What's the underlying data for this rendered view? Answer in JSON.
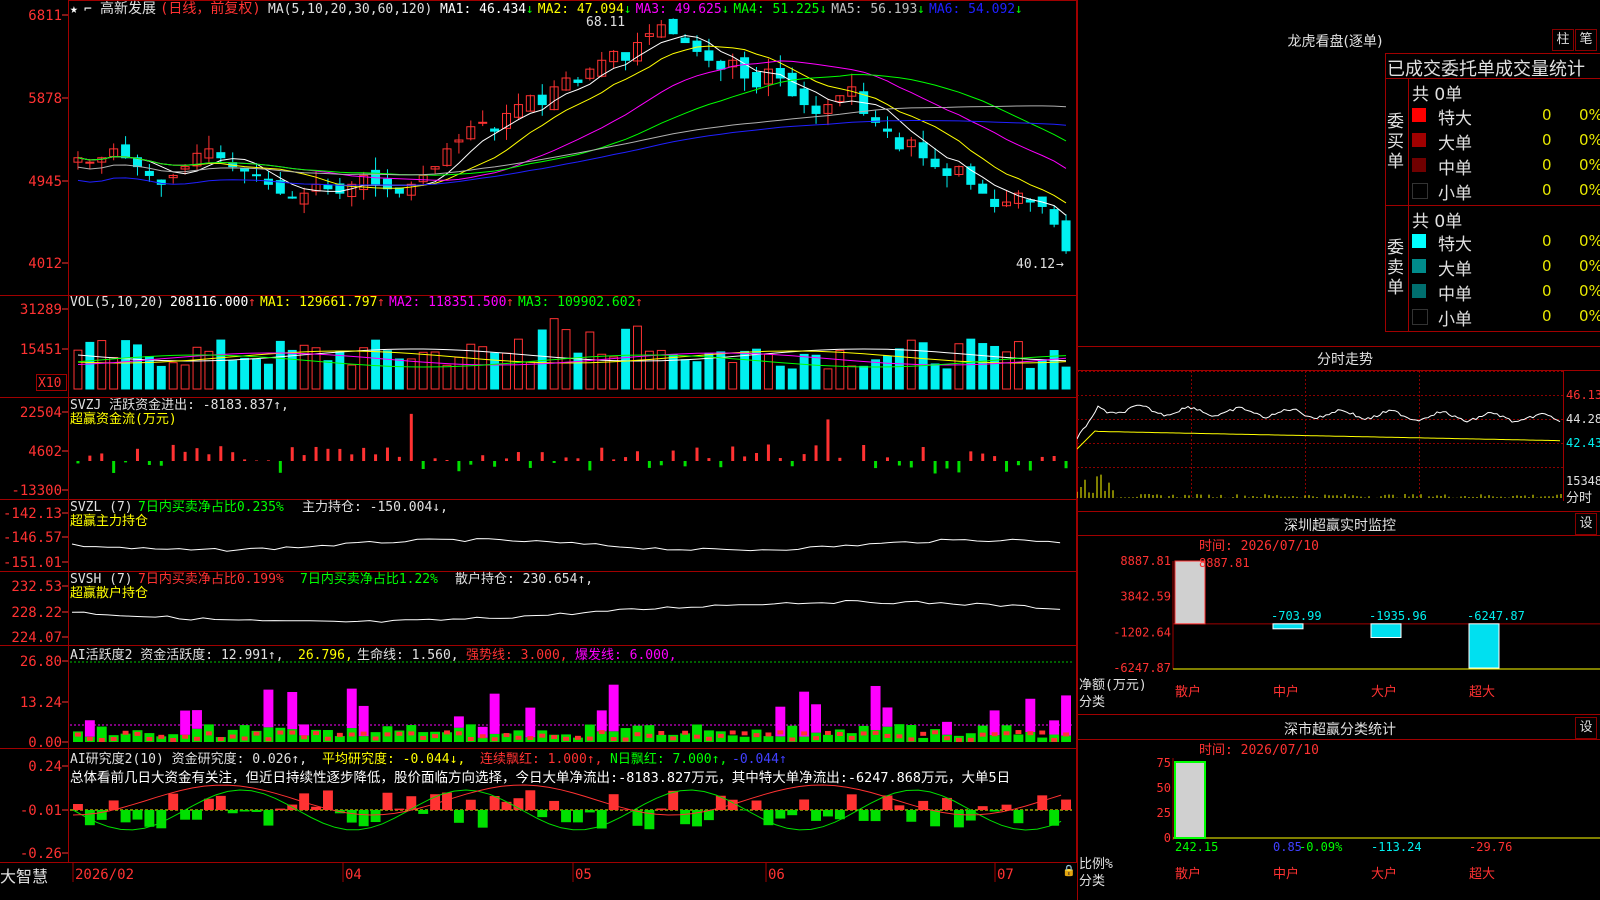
{
  "app": {
    "brand": "大智慧",
    "stock": "高新发展",
    "period": "(日线，前复权)"
  },
  "colors": {
    "up": "#ff3232",
    "down": "#00f0f0",
    "grid": "#8b0000",
    "ma1": "#ffffff",
    "ma2": "#ffff00",
    "ma3": "#ff00ff",
    "ma4": "#00ff00",
    "ma5": "#b0b0b0",
    "ma6": "#2020ff",
    "green": "#00e000"
  },
  "price_panel": {
    "ma_header": "MA(5,10,20,30,60,120)",
    "ma": [
      {
        "label": "MA1: 46.434",
        "arrow": "↓",
        "color": "#ffffff"
      },
      {
        "label": "MA2: 47.094",
        "arrow": "↓",
        "color": "#ffff00"
      },
      {
        "label": "MA3: 49.625",
        "arrow": "↓",
        "color": "#ff00ff"
      },
      {
        "label": "MA4: 51.225",
        "arrow": "↓",
        "color": "#00ff00"
      },
      {
        "label": "MA5: 56.193",
        "arrow": "↓",
        "color": "#c0c0c0"
      },
      {
        "label": "MA6: 54.092",
        "arrow": "↓",
        "color": "#2020ff"
      }
    ],
    "yticks": [
      "6811",
      "5878",
      "4945",
      "4012"
    ],
    "high_label": "68.11",
    "low_label": "40.12"
  },
  "volume_panel": {
    "header": "VOL(5,10,20)",
    "items": [
      {
        "label": "208116.000",
        "arrow": "↑",
        "color": "#ffffff"
      },
      {
        "label": "MA1: 129661.797",
        "arrow": "↑",
        "color": "#ffff00"
      },
      {
        "label": "MA2: 118351.500",
        "arrow": "↑",
        "color": "#ff00ff"
      },
      {
        "label": "MA3: 109902.602",
        "arrow": "↑",
        "color": "#00ff00"
      }
    ],
    "yticks": [
      "31289",
      "15451"
    ],
    "unit": "X10"
  },
  "svzj_panel": {
    "line1": "SVZJ  活跃资金进出: -8183.837↑,",
    "line2": "超赢资金流(万元)",
    "yticks": [
      "22504",
      "4602",
      "-13300"
    ]
  },
  "svzl_panel": {
    "prefix": "SVZL (7)",
    "part1": "7日内买卖净占比0.235%",
    "part2": "主力持仓: -150.004↓,",
    "line2": "超赢主力持仓",
    "yticks": [
      "-142.13",
      "-146.57",
      "-151.01"
    ]
  },
  "svsh_panel": {
    "prefix": "SVSH (7)",
    "part1": "7日内买卖净占比0.199%",
    "part2": "7日内买卖净占比1.22%",
    "part3": "散户持仓: 230.654↑,",
    "line2": "超赢散户持仓",
    "yticks": [
      "232.53",
      "228.22",
      "224.07"
    ]
  },
  "ai_active_panel": {
    "p1": "AI活跃度2 资金活跃度: 12.991↑,",
    "p2": "26.796,",
    "p3": "生命线: 1.560,",
    "p4": "强势线: 3.000,",
    "p5": "爆发线: 6.000,",
    "yticks": [
      "26.80",
      "13.24",
      "0.00"
    ]
  },
  "ai_research_panel": {
    "p1": "AI研究度2(10) 资金研究度: 0.026↑,",
    "p2": "平均研究度: -0.044↓,",
    "p3": "连续飘红: 1.000↑,",
    "p4": "N日飘红: 7.000↑,",
    "p5": "-0.044↑",
    "summary": "总体看前几日大资金有关注，但近日持续性逐步降低，股价面临方向选择，今日大单净流出:-8183.827万元，其中特大单净流出:-6247.868万元，大单5日",
    "yticks": [
      "0.24",
      "-0.01",
      "-0.26"
    ]
  },
  "x_axis": [
    "2026/02",
    "04",
    "05",
    "06",
    "07"
  ],
  "dragon_tiger": {
    "title": "龙虎看盘(逐单)",
    "btn1": "柱",
    "btn2": "笔",
    "subtitle": "已成交委托单成交量统计",
    "buy_total": "共 0单",
    "sell_total": "共 0单",
    "buy_label": "委买单",
    "sell_label": "委卖单",
    "buy_rows": [
      {
        "name": "特大",
        "count": "0",
        "pct": "0%",
        "color": "#ff0000"
      },
      {
        "name": "大单",
        "count": "0",
        "pct": "0%",
        "color": "#a00000"
      },
      {
        "name": "中单",
        "count": "0",
        "pct": "0%",
        "color": "#700000"
      },
      {
        "name": "小单",
        "count": "0",
        "pct": "0%",
        "color": "#000000"
      }
    ],
    "sell_rows": [
      {
        "name": "特大",
        "count": "0",
        "pct": "0%",
        "color": "#00ffff"
      },
      {
        "name": "大单",
        "count": "0",
        "pct": "0%",
        "color": "#008b8b"
      },
      {
        "name": "中单",
        "count": "0",
        "pct": "0%",
        "color": "#006f6f"
      },
      {
        "name": "小单",
        "count": "0",
        "pct": "0%",
        "color": "#000000"
      }
    ]
  },
  "intraday": {
    "title": "分时走势",
    "yticks": [
      "46.13",
      "44.28",
      "42.43"
    ],
    "vol_label": "15348",
    "bottom_label": "分时"
  },
  "sz_monitor": {
    "title": "深圳超赢实时监控",
    "settings": "设",
    "date": "时间: 2026/07/10",
    "top_value": "8887.81",
    "yticks": [
      "8887.81",
      "3842.59",
      "-1202.64",
      "-6247.87"
    ],
    "ylabel": "净额(万元)",
    "xlabel": "分类",
    "categories": [
      "散户",
      "中户",
      "大户",
      "超大"
    ]
  },
  "sz_class": {
    "title": "深市超赢分类统计",
    "settings": "设",
    "date": "时间: 2026/07/10",
    "yticks": [
      "75",
      "50",
      "25",
      "0"
    ],
    "ylabel": "比例%",
    "xlabel": "分类",
    "categories": [
      "散户",
      "中户",
      "大户",
      "超大"
    ],
    "mid_label": "-0.09%"
  },
  "chart_data": [
    {
      "type": "bar",
      "title": "深圳超赢实时监控",
      "ylabel": "净额(万元)",
      "xlabel": "分类",
      "categories": [
        "散户",
        "中户",
        "大户",
        "超大"
      ],
      "values": [
        8887.81,
        -703.99,
        -1935.96,
        -6247.87
      ],
      "ylim": [
        -6247.87,
        8887.81
      ]
    },
    {
      "type": "bar",
      "title": "深市超赢分类统计",
      "ylabel": "比例%",
      "xlabel": "分类",
      "categories": [
        "散户",
        "中户",
        "大户",
        "超大"
      ],
      "values": [
        242.15,
        0.85,
        -113.24,
        -29.76
      ],
      "ylim": [
        0,
        75
      ]
    },
    {
      "type": "line",
      "title": "高新发展(日线，前复权)",
      "x": [
        "2026/02",
        "04",
        "05",
        "06",
        "07"
      ],
      "ylim": [
        40.12,
        68.11
      ],
      "series": [
        {
          "name": "MA1",
          "values": [
            52,
            51,
            50,
            49,
            53,
            58,
            62,
            65,
            60,
            57,
            55,
            52,
            49,
            46.434
          ]
        },
        {
          "name": "MA2",
          "values": [
            51,
            51,
            50,
            49,
            52,
            56,
            60,
            63,
            61,
            58,
            56,
            53,
            50,
            47.094
          ]
        },
        {
          "name": "MA3",
          "values": [
            51,
            51.5,
            51,
            50,
            51,
            54,
            58,
            61,
            61,
            59,
            57,
            54.5,
            52,
            49.625
          ]
        },
        {
          "name": "MA4",
          "values": [
            50,
            50.5,
            50.5,
            50,
            50.5,
            53,
            56,
            59,
            60,
            59.5,
            58,
            56,
            53.5,
            51.225
          ]
        },
        {
          "name": "MA5",
          "values": [
            47.5,
            48.5,
            49.5,
            50,
            51,
            53,
            55,
            56.5,
            57.5,
            58,
            58,
            57.8,
            57,
            56.193
          ]
        },
        {
          "name": "MA6",
          "values": [
            49,
            49.2,
            49.3,
            49.5,
            50,
            50.5,
            51.5,
            52.5,
            53,
            53.5,
            54,
            54.2,
            54.3,
            54.092
          ]
        }
      ]
    }
  ]
}
